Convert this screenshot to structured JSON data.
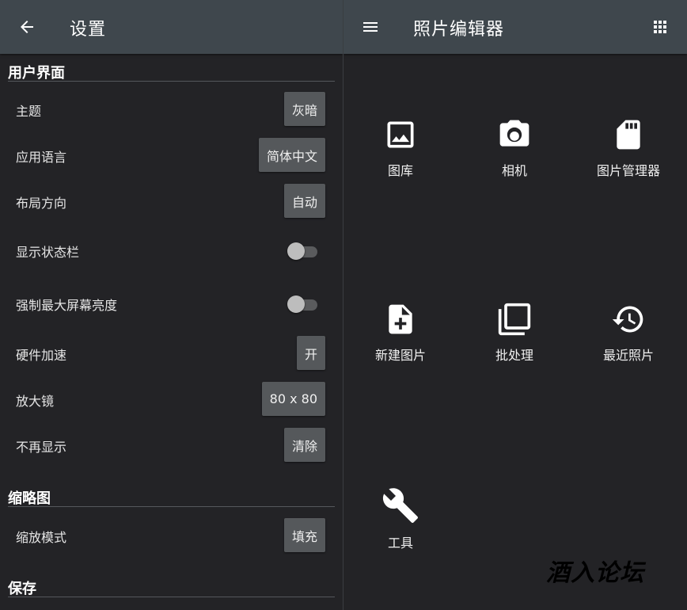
{
  "settings": {
    "title": "设置",
    "sections": [
      {
        "title": "用户界面"
      },
      {
        "title": "缩略图"
      },
      {
        "title": "保存"
      }
    ],
    "rows": [
      {
        "label": "主题",
        "value": "灰暗"
      },
      {
        "label": "应用语言",
        "value": "简体中文"
      },
      {
        "label": "布局方向",
        "value": "自动"
      },
      {
        "label": "显示状态栏"
      },
      {
        "label": "强制最大屏幕亮度"
      },
      {
        "label": "硬件加速",
        "value": "开"
      },
      {
        "label": "放大镜",
        "value": "80 x 80"
      },
      {
        "label": "不再显示",
        "value": "清除"
      },
      {
        "label": "缩放模式",
        "value": "填充"
      }
    ],
    "switches": {
      "status_bar_on": false,
      "max_brightness_on": false
    }
  },
  "editor": {
    "title": "照片编辑器",
    "tiles": [
      {
        "label": "图库",
        "icon": "image-icon"
      },
      {
        "label": "相机",
        "icon": "camera-icon"
      },
      {
        "label": "图片管理器",
        "icon": "sd-card-icon"
      },
      {
        "label": "新建图片",
        "icon": "new-file-icon"
      },
      {
        "label": "批处理",
        "icon": "batch-icon"
      },
      {
        "label": "最近照片",
        "icon": "history-icon"
      },
      {
        "label": "工具",
        "icon": "wrench-icon"
      }
    ]
  },
  "watermark": "酒入论坛",
  "colors": {
    "appbar": "#3f474d",
    "background": "#232326",
    "button": "#55585b"
  }
}
